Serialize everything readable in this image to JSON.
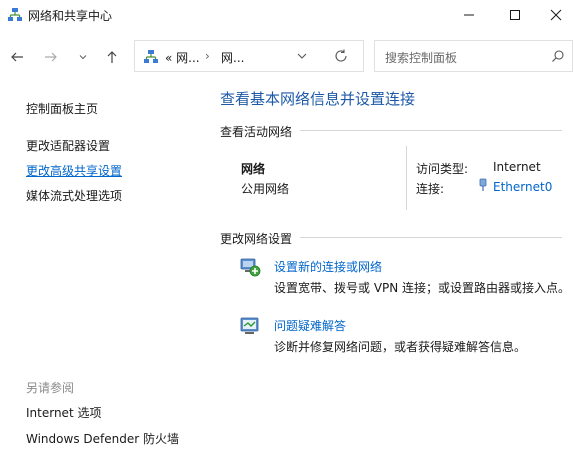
{
  "window": {
    "title": "网络和共享中心"
  },
  "address": {
    "segment1": "« 网...",
    "separator": "›",
    "segment2": "网..."
  },
  "search": {
    "placeholder": "搜索控制面板"
  },
  "sidebar": {
    "home": "控制面板主页",
    "adapter": "更改适配器设置",
    "advanced": "更改高级共享设置",
    "media": "媒体流式处理选项",
    "see_also": "另请参阅",
    "internet_options": "Internet 选项",
    "firewall": "Windows Defender 防火墙"
  },
  "main": {
    "title": "查看基本网络信息并设置连接",
    "active_networks": "查看活动网络",
    "network_name": "网络",
    "network_category": "公用网络",
    "access_type_label": "访问类型:",
    "access_type_value": "Internet",
    "connection_label": "连接:",
    "connection_value": "Ethernet0",
    "change_settings": "更改网络设置",
    "tasks": [
      {
        "label": "设置新的连接或网络",
        "desc": "设置宽带、拨号或 VPN 连接；或设置路由器或接入点。"
      },
      {
        "label": "问题疑难解答",
        "desc": "诊断并修复网络问题，或者获得疑难解答信息。"
      }
    ]
  },
  "colors": {
    "link": "#0066cc",
    "title_blue": "#1e5aa8",
    "muted": "#8a8a8a"
  }
}
